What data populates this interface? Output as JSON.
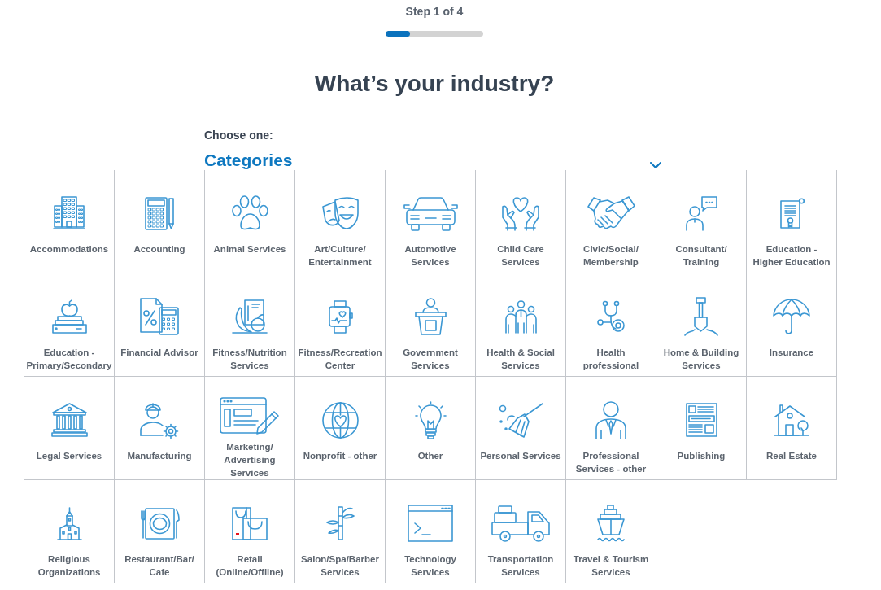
{
  "step": {
    "text": "Step 1 of 4",
    "level": 0.25
  },
  "title": "What’s your industry?",
  "prompt": "Choose one:",
  "dropdown": {
    "label": "Categories"
  },
  "industries": [
    {
      "label": "Accommodations",
      "selected": false
    },
    {
      "label": "Accounting",
      "selected": false
    },
    {
      "label": "Animal Services",
      "selected": false
    },
    {
      "label": "Art/Culture/\nEntertainment",
      "selected": false
    },
    {
      "label": "Automotive\nServices",
      "selected": false
    },
    {
      "label": "Child Care\nServices",
      "selected": false
    },
    {
      "label": "Civic/Social/\nMembership",
      "selected": false
    },
    {
      "label": "Consultant/\nTraining",
      "selected": false
    },
    {
      "label": "Education -\nHigher Education",
      "selected": false
    },
    {
      "label": "Education -\nPrimary/Secondary",
      "selected": false
    },
    {
      "label": "Financial Advisor",
      "selected": false
    },
    {
      "label": "Fitness/Nutrition\nServices",
      "selected": false
    },
    {
      "label": "Fitness/Recreation\nCenter",
      "selected": false
    },
    {
      "label": "Government\nServices",
      "selected": false
    },
    {
      "label": "Health & Social\nServices",
      "selected": false
    },
    {
      "label": "Health\nprofessional",
      "selected": false
    },
    {
      "label": "Home & Building\nServices",
      "selected": false
    },
    {
      "label": "Insurance",
      "selected": false
    },
    {
      "label": "Legal Services",
      "selected": false
    },
    {
      "label": "Manufacturing",
      "selected": false
    },
    {
      "label": "Marketing/\nAdvertising\nServices",
      "selected": false
    },
    {
      "label": "Nonprofit - other",
      "selected": false
    },
    {
      "label": "Other",
      "selected": false
    },
    {
      "label": "Personal Services",
      "selected": false
    },
    {
      "label": "Professional\nServices - other",
      "selected": false
    },
    {
      "label": "Publishing",
      "selected": false
    },
    {
      "label": "Real Estate",
      "selected": false
    },
    {
      "label": "Religious\nOrganizations",
      "selected": false
    },
    {
      "label": "Restaurant/Bar/\nCafe",
      "selected": false
    },
    {
      "label": "Retail\n(Online/Offline)",
      "selected": false
    },
    {
      "label": "Salon/Spa/Barber\nServices",
      "selected": false
    },
    {
      "label": "Technology\nServices",
      "selected": false
    },
    {
      "label": "Transportation\nServices",
      "selected": false
    },
    {
      "label": "Travel & Tourism\nServices",
      "selected": false
    }
  ]
}
